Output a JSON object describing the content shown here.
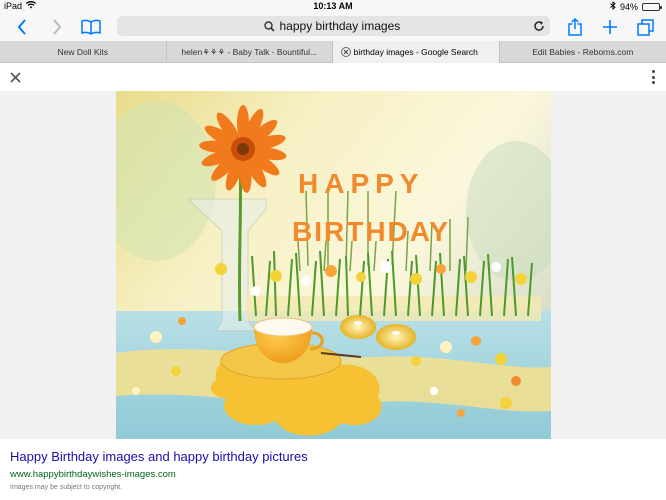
{
  "status_bar": {
    "device": "iPad",
    "time": "10:13 AM",
    "battery_text": "94%",
    "battery_level": 0.94,
    "battery_color": "#4cd964"
  },
  "toolbar": {
    "icons": [
      "back-icon",
      "forward-icon",
      "bookmarks-icon",
      "share-icon",
      "new-tab-icon",
      "tabs-icon"
    ],
    "search_query": "happy birthday images",
    "accent_color": "#007aff"
  },
  "tabs": [
    {
      "label": "New Doll Kits",
      "active": false
    },
    {
      "label": "helen⚘⚘⚘ - Baby Talk - Bountiful...",
      "active": false
    },
    {
      "label": "birthday images - Google Search",
      "active": true
    },
    {
      "label": "Edit Babies - Reborns.com",
      "active": false
    }
  ],
  "image": {
    "letters_happy": "HAPPY",
    "letters_birthday": "BIRTHDAY",
    "letter_color": "#f08a2c"
  },
  "result": {
    "title": "Happy Birthday images and happy birthday pictures",
    "url": "www.happybirthdaywishes-images.com",
    "note": "Images may be subject to copyright.",
    "title_color": "#1a0dab",
    "url_color": "#006621"
  }
}
